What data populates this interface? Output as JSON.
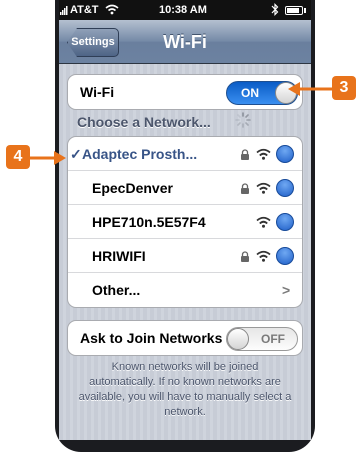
{
  "status_bar": {
    "carrier": "AT&T",
    "time": "10:38 AM"
  },
  "nav": {
    "back_label": "Settings",
    "title": "Wi-Fi"
  },
  "wifi_row": {
    "label": "Wi-Fi",
    "toggle_label": "ON"
  },
  "networks_header": "Choose a Network...",
  "networks": [
    {
      "name": "Adaptec Prosth...",
      "selected": true,
      "locked": true
    },
    {
      "name": "EpecDenver",
      "selected": false,
      "locked": true
    },
    {
      "name": "HPE710n.5E57F4",
      "selected": false,
      "locked": false
    },
    {
      "name": "HRIWIFI",
      "selected": false,
      "locked": true
    }
  ],
  "other": {
    "label": "Other...",
    "chevron": ">"
  },
  "ask_row": {
    "label": "Ask to Join Networks",
    "toggle_label": "OFF"
  },
  "footer_text": "Known networks will be joined automatically. If no known networks are available, you will have to manually select a network.",
  "callouts": {
    "a": "3",
    "b": "4"
  },
  "colors": {
    "callout": "#e8731b",
    "selected_text": "#385487",
    "toggle_on": "#1f6fd6"
  },
  "icons": [
    "signal-icon",
    "wifi-status-icon",
    "bluetooth-icon",
    "battery-icon",
    "lock-icon",
    "wifi-signal-icon",
    "info-icon",
    "chevron-right-icon",
    "checkmark-icon",
    "spinner-icon",
    "arrow-icon"
  ]
}
